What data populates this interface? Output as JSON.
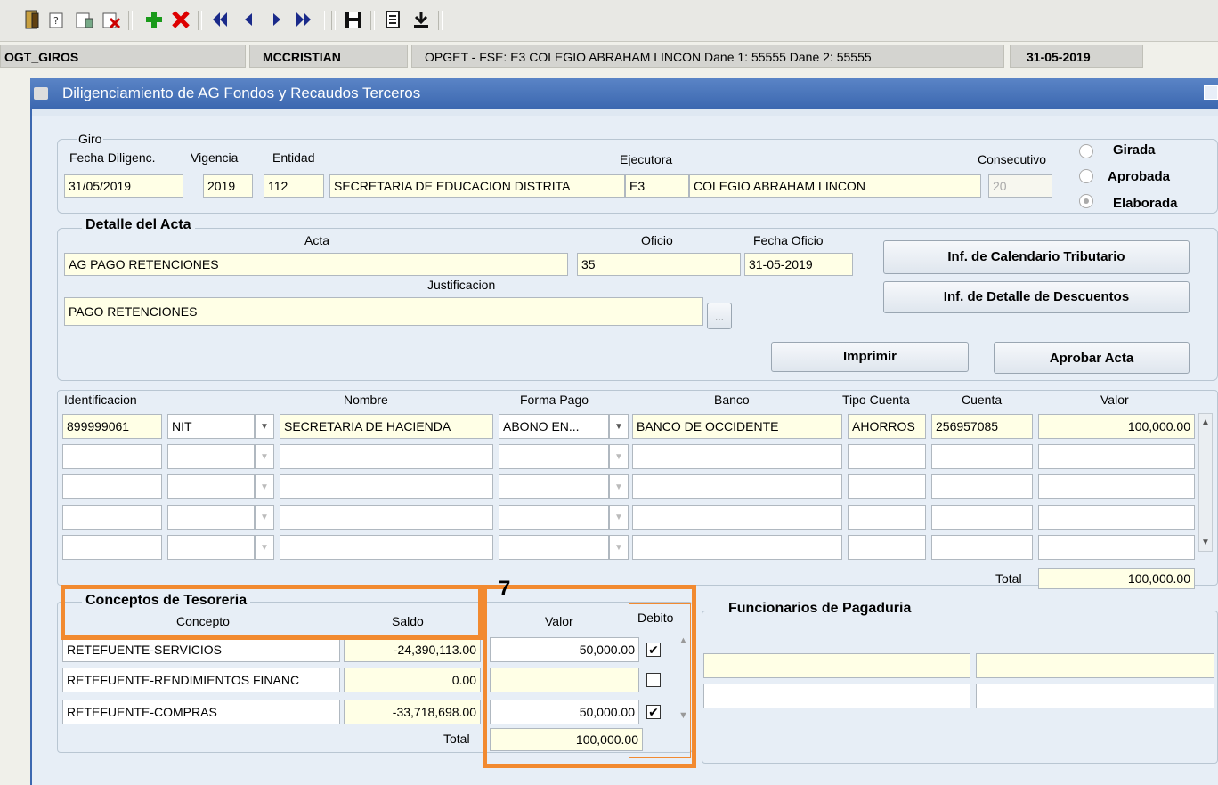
{
  "toolbar": {
    "icons": [
      "exit-icon",
      "query-icon",
      "execute-query-icon",
      "cancel-query-icon",
      "insert-record-icon",
      "delete-record-icon",
      "first-record-icon",
      "previous-record-icon",
      "next-record-icon",
      "last-record-icon",
      "save-icon",
      "print-icon",
      "download-icon"
    ]
  },
  "status": {
    "module": "OGT_GIROS",
    "user": "MCCRISTIAN",
    "context": "OPGET - FSE: E3 COLEGIO ABRAHAM LINCON  Dane 1: 55555  Dane 2: 55555",
    "date": "31-05-2019"
  },
  "window": {
    "title": "Diligenciamiento de AG Fondos y Recaudos Terceros"
  },
  "giro": {
    "frame_label": "Giro",
    "labels": {
      "fecha": "Fecha Diligenc.",
      "vigencia": "Vigencia",
      "entidad": "Entidad",
      "ejecutora": "Ejecutora",
      "consecutivo": "Consecutivo"
    },
    "fecha": "31/05/2019",
    "vigencia": "2019",
    "entidad_code": "112",
    "entidad_name": "SECRETARIA DE EDUCACION DISTRITA",
    "ejecutora_code": "E3",
    "ejecutora_name": "COLEGIO ABRAHAM LINCON",
    "consecutivo": "20",
    "estado": {
      "girada": "Girada",
      "aprobada": "Aprobada",
      "elaborada": "Elaborada",
      "selected": "Elaborada"
    }
  },
  "acta": {
    "frame_label": "Detalle del Acta",
    "labels": {
      "acta": "Acta",
      "oficio": "Oficio",
      "fecha_oficio": "Fecha Oficio",
      "justificacion": "Justificacion"
    },
    "acta": "AG PAGO RETENCIONES",
    "oficio": "35",
    "fecha_oficio": "31-05-2019",
    "justificacion": "PAGO RETENCIONES",
    "more_label": "...",
    "buttons": {
      "calendario": "Inf. de Calendario Tributario",
      "descuentos": "Inf. de Detalle de Descuentos",
      "imprimir": "Imprimir",
      "aprobar": "Aprobar Acta"
    }
  },
  "beneficiarios": {
    "headers": {
      "identificacion": "Identificacion",
      "nombre": "Nombre",
      "forma_pago": "Forma Pago",
      "banco": "Banco",
      "tipo_cuenta": "Tipo Cuenta",
      "cuenta": "Cuenta",
      "valor": "Valor"
    },
    "rows": [
      {
        "identificacion": "899999061",
        "tipo_id": "NIT",
        "nombre": "SECRETARIA DE HACIENDA",
        "forma_pago": "ABONO EN...",
        "banco": "BANCO DE OCCIDENTE",
        "tipo_cuenta": "AHORROS",
        "cuenta": "256957085",
        "valor": "100,000.00"
      },
      {
        "identificacion": "",
        "tipo_id": "",
        "nombre": "",
        "forma_pago": "",
        "banco": "",
        "tipo_cuenta": "",
        "cuenta": "",
        "valor": ""
      },
      {
        "identificacion": "",
        "tipo_id": "",
        "nombre": "",
        "forma_pago": "",
        "banco": "",
        "tipo_cuenta": "",
        "cuenta": "",
        "valor": ""
      },
      {
        "identificacion": "",
        "tipo_id": "",
        "nombre": "",
        "forma_pago": "",
        "banco": "",
        "tipo_cuenta": "",
        "cuenta": "",
        "valor": ""
      },
      {
        "identificacion": "",
        "tipo_id": "",
        "nombre": "",
        "forma_pago": "",
        "banco": "",
        "tipo_cuenta": "",
        "cuenta": "",
        "valor": ""
      }
    ],
    "total_label": "Total",
    "total": "100,000.00"
  },
  "conceptos": {
    "frame_label": "Conceptos de Tesoreria",
    "headers": {
      "concepto": "Concepto",
      "saldo": "Saldo",
      "valor": "Valor",
      "debito": "Debito"
    },
    "rows": [
      {
        "concepto": "RETEFUENTE-SERVICIOS",
        "saldo": "-24,390,113.00",
        "valor": "50,000.00",
        "debito": true
      },
      {
        "concepto": "RETEFUENTE-RENDIMIENTOS FINANC",
        "saldo": "0.00",
        "valor": "",
        "debito": false
      },
      {
        "concepto": "RETEFUENTE-COMPRAS",
        "saldo": "-33,718,698.00",
        "valor": "50,000.00",
        "debito": true
      }
    ],
    "total_label": "Total",
    "total": "100,000.00",
    "annotation": "7"
  },
  "funcionarios": {
    "frame_label": "Funcionarios de Pagaduria"
  },
  "colors": {
    "highlight": "#f28a30",
    "field": "#ffffe6",
    "title_bar": "#3c68b0"
  }
}
